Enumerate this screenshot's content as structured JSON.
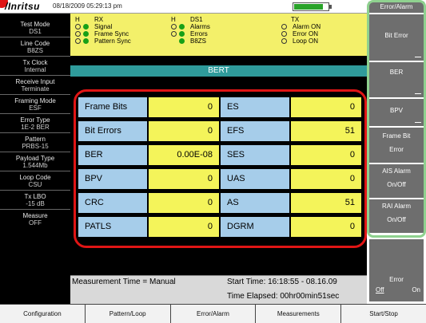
{
  "header": {
    "brand": "/Inritsu",
    "datetime": "08/18/2009 05:29:13 pm",
    "battery_level": 0.85
  },
  "left_panel": {
    "items": [
      {
        "label": "Test Mode",
        "value": "DS1"
      },
      {
        "label": "Line Code",
        "value": "B8ZS"
      },
      {
        "label": "Tx Clock",
        "value": "Internal"
      },
      {
        "label": "Receive Input",
        "value": "Terminate"
      },
      {
        "label": "Framing Mode",
        "value": "ESF"
      },
      {
        "label": "Error Type",
        "value": "1E-2 BER"
      },
      {
        "label": "Pattern",
        "value": "PRBS-15"
      },
      {
        "label": "Payload Type",
        "value": "1.544Mb"
      },
      {
        "label": "Loop Code",
        "value": "CSU"
      },
      {
        "label": "Tx LBO",
        "value": "-15 dB"
      },
      {
        "label": "Measure",
        "value": "OFF"
      }
    ]
  },
  "status": {
    "h1": "H",
    "rx_head": "RX",
    "rx_rows": [
      "Signal",
      "Frame Sync",
      "Pattern Sync"
    ],
    "h2": "H",
    "ds1_head": "DS1",
    "ds1_rows": [
      "Alarms",
      "Errors",
      "B8ZS"
    ],
    "tx_head": "TX",
    "tx_rows": [
      "Alarm ON",
      "Error ON",
      "Loop ON"
    ]
  },
  "bert": {
    "title": "BERT",
    "rows": [
      {
        "l1": "Frame Bits",
        "v1": "0",
        "l2": "ES",
        "v2": "0"
      },
      {
        "l1": "Bit Errors",
        "v1": "0",
        "l2": "EFS",
        "v2": "51"
      },
      {
        "l1": "BER",
        "v1": "0.00E-08",
        "l2": "SES",
        "v2": "0"
      },
      {
        "l1": "BPV",
        "v1": "0",
        "l2": "UAS",
        "v2": "0"
      },
      {
        "l1": "CRC",
        "v1": "0",
        "l2": "AS",
        "v2": "51"
      },
      {
        "l1": "PATLS",
        "v1": "0",
        "l2": "DGRM",
        "v2": "0"
      }
    ]
  },
  "info": {
    "measurement_time": "Measurement Time = Manual",
    "start_time": "Start Time: 16:18:55 - 08.16.09",
    "time_elapsed": "Time Elapsed: 00hr00min51sec"
  },
  "right_keys": {
    "title": "Error/Alarm",
    "keys": [
      {
        "l1": "Bit Error",
        "l2": ""
      },
      {
        "l1": "BER",
        "l2": ""
      },
      {
        "l1": "BPV",
        "l2": ""
      },
      {
        "l1": "Frame Bit",
        "l2": "Error"
      },
      {
        "l1": "AIS Alarm",
        "l2": "On/Off"
      },
      {
        "l1": "RAI Alarm",
        "l2": "On/Off"
      }
    ],
    "bottom": {
      "l1": "Error",
      "off": "Off",
      "on": "On"
    }
  },
  "tabs": [
    "Configuration",
    "Pattern/Loop",
    "Error/Alarm",
    "Measurements",
    "Start/Stop"
  ]
}
